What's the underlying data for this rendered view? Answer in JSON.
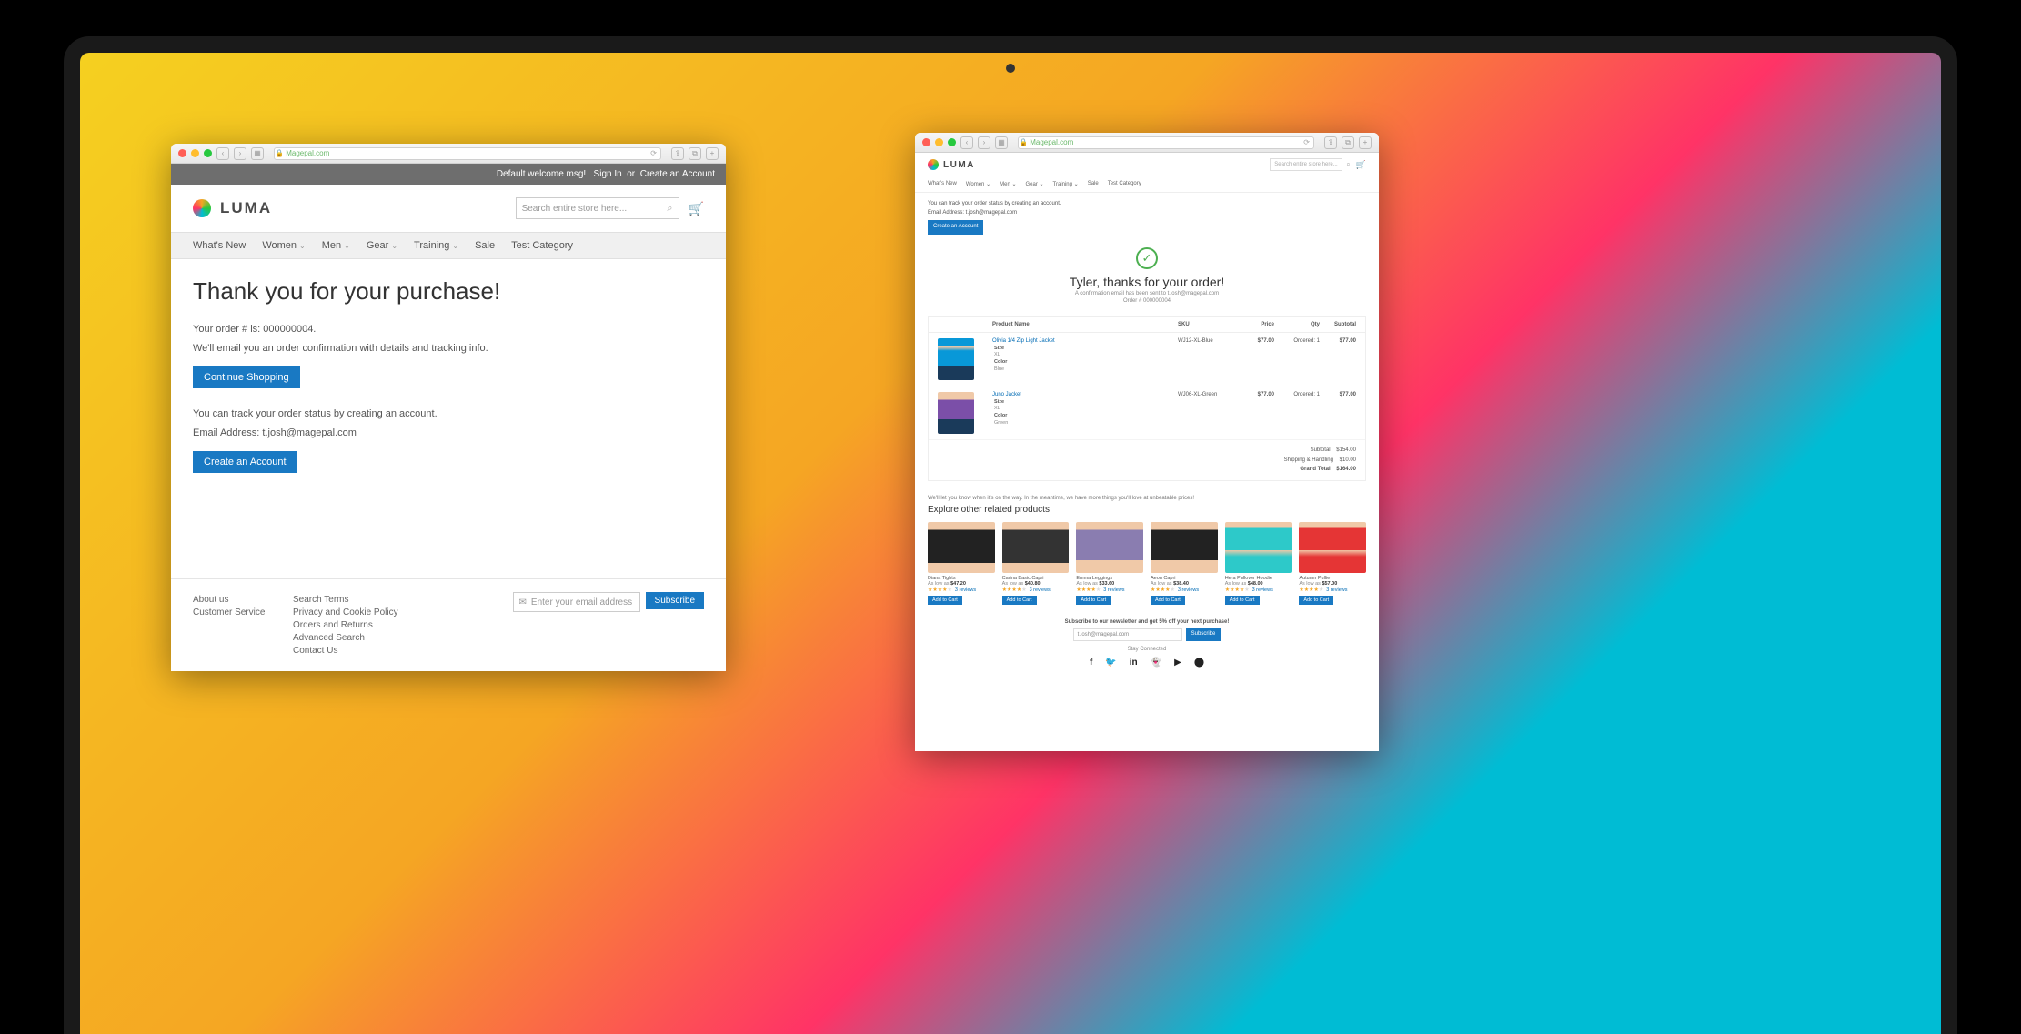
{
  "url": "Magepal.com",
  "left": {
    "topbar": {
      "welcome": "Default welcome msg!",
      "signin": "Sign In",
      "or": "or",
      "create": "Create an Account"
    },
    "brand": "LUMA",
    "search_placeholder": "Search entire store here...",
    "nav": [
      "What's New",
      "Women",
      "Men",
      "Gear",
      "Training",
      "Sale",
      "Test Category"
    ],
    "title": "Thank you for your purchase!",
    "order_line": "Your order # is: 000000004.",
    "email_line": "We'll email you an order confirmation with details and tracking info.",
    "continue_btn": "Continue Shopping",
    "track_line": "You can track your order status by creating an account.",
    "email_addr_line": "Email Address: t.josh@magepal.com",
    "create_btn": "Create an Account",
    "footer": {
      "col1": [
        "About us",
        "Customer Service"
      ],
      "col2": [
        "Search Terms",
        "Privacy and Cookie Policy",
        "Orders and Returns",
        "Advanced Search",
        "Contact Us"
      ],
      "sub_placeholder": "Enter your email address",
      "sub_btn": "Subscribe"
    }
  },
  "right": {
    "brand": "LUMA",
    "search_placeholder": "Search entire store here...",
    "nav": [
      "What's New",
      "Women",
      "Men",
      "Gear",
      "Training",
      "Sale",
      "Test Category"
    ],
    "track_line": "You can track your order status by creating an account.",
    "email_addr_line": "Email Address: t.josh@magepal.com",
    "create_btn": "Create an Account",
    "h1": "Tyler, thanks for your order!",
    "conf_line": "A confirmation email has been sent to t.josh@magepal.com",
    "order_num_line": "Order # 000000004",
    "cols": {
      "name": "Product Name",
      "sku": "SKU",
      "price": "Price",
      "qty": "Qty",
      "subtotal": "Subtotal"
    },
    "items": [
      {
        "name": "Olivia 1/4 Zip Light Jacket",
        "sku": "WJ12-XL-Blue",
        "price": "$77.00",
        "qty": "Ordered: 1",
        "subtotal": "$77.00",
        "size": "XL",
        "color": "Blue",
        "img": "blue"
      },
      {
        "name": "Juno Jacket",
        "sku": "WJ06-XL-Green",
        "price": "$77.00",
        "qty": "Ordered: 1",
        "subtotal": "$77.00",
        "size": "XL",
        "color": "Green",
        "img": "purple"
      }
    ],
    "totals": {
      "subtotal_l": "Subtotal",
      "subtotal_v": "$154.00",
      "ship_l": "Shipping & Handling",
      "ship_v": "$10.00",
      "grand_l": "Grand Total",
      "grand_v": "$164.00"
    },
    "meantime": "We'll let you know when it's on the way. In the meantime, we have more things you'll love at unbeatable prices!",
    "explore_h": "Explore other related products",
    "related": [
      {
        "name": "Diana Tights",
        "price": "$47.20",
        "reviews": "3 reviews",
        "img": "leg1"
      },
      {
        "name": "Carina Basic Capri",
        "price": "$40.80",
        "reviews": "3 reviews",
        "img": "leg2"
      },
      {
        "name": "Emma Leggings",
        "price": "$33.60",
        "reviews": "3 reviews",
        "img": "leg3"
      },
      {
        "name": "Aeon Capri",
        "price": "$38.40",
        "reviews": "3 reviews",
        "img": "leg4"
      },
      {
        "name": "Hera Pullover Hoodie",
        "price": "$48.00",
        "reviews": "3 reviews",
        "img": "leg5"
      },
      {
        "name": "Autumn Pullie",
        "price": "$57.00",
        "reviews": "3 reviews",
        "img": "leg6"
      }
    ],
    "as_low_as": "As low as",
    "add_btn": "Add to Cart",
    "newsletter_h": "Subscribe to our newsletter and get 5% off your next purchase!",
    "newsletter_email": "t.josh@magepal.com",
    "newsletter_btn": "Subscribe",
    "stay_connected": "Stay Connected"
  }
}
